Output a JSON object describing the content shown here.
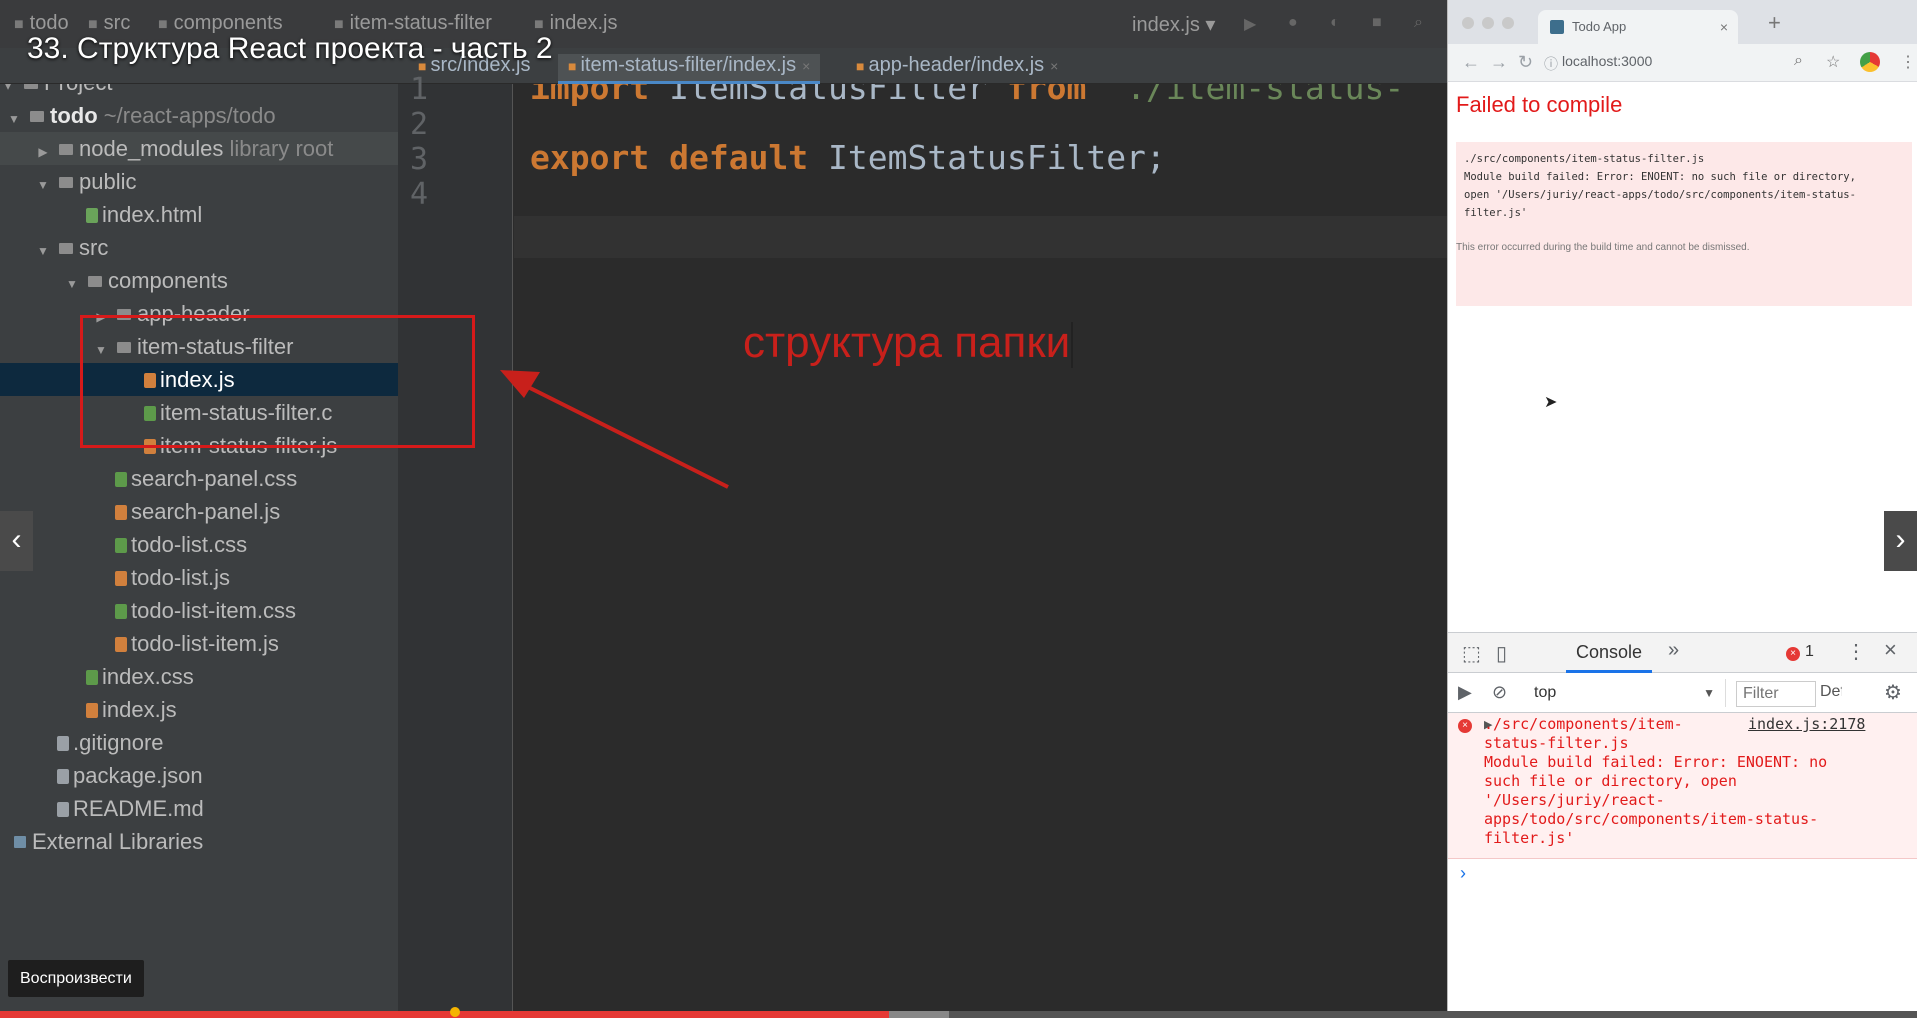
{
  "video": {
    "title": "33. Структура React проекта - часть 2",
    "play_label": "Воспроизвести",
    "prev_icon": "‹",
    "next_icon": "›",
    "progress": {
      "played_fraction": 0.464,
      "buffered_fraction": 0.495,
      "knob_fraction": 0.235
    }
  },
  "ide": {
    "breadcrumbs": [
      "todo",
      "src",
      "components",
      "item-status-filter",
      "index.js"
    ],
    "run_config": "index.js ▾",
    "tabs": [
      {
        "label": "src/index.js",
        "active": false
      },
      {
        "label": "item-status-filter/index.js",
        "active": true
      },
      {
        "label": "app-header/index.js",
        "active": false
      }
    ],
    "project_header": "Project",
    "tree": [
      {
        "label": "todo",
        "hint": "~/react-apps/todo",
        "type": "folder",
        "depth": 0,
        "expanded": true,
        "bold": true
      },
      {
        "label": "node_modules",
        "hint": "library root",
        "type": "folder",
        "depth": 1,
        "expanded": false,
        "alt": true
      },
      {
        "label": "public",
        "type": "folder",
        "depth": 1,
        "expanded": true
      },
      {
        "label": "index.html",
        "type": "html",
        "depth": 2
      },
      {
        "label": "src",
        "type": "folder",
        "depth": 1,
        "expanded": true
      },
      {
        "label": "components",
        "type": "folder",
        "depth": 2,
        "expanded": true
      },
      {
        "label": "app-header",
        "type": "folder",
        "depth": 3,
        "expanded": false
      },
      {
        "label": "item-status-filter",
        "type": "folder",
        "depth": 3,
        "expanded": true
      },
      {
        "label": "index.js",
        "type": "js",
        "depth": 4,
        "selected": true
      },
      {
        "label": "item-status-filter.c",
        "type": "css",
        "depth": 4
      },
      {
        "label": "item-status-filter.js",
        "type": "js",
        "depth": 4
      },
      {
        "label": "search-panel.css",
        "type": "css",
        "depth": 3
      },
      {
        "label": "search-panel.js",
        "type": "js",
        "depth": 3
      },
      {
        "label": "todo-list.css",
        "type": "css",
        "depth": 3
      },
      {
        "label": "todo-list.js",
        "type": "js",
        "depth": 3
      },
      {
        "label": "todo-list-item.css",
        "type": "css",
        "depth": 3
      },
      {
        "label": "todo-list-item.js",
        "type": "js",
        "depth": 3
      },
      {
        "label": "index.css",
        "type": "css",
        "depth": 2
      },
      {
        "label": "index.js",
        "type": "js",
        "depth": 2
      },
      {
        "label": ".gitignore",
        "type": "gen",
        "depth": 1
      },
      {
        "label": "package.json",
        "type": "gen",
        "depth": 1
      },
      {
        "label": "README.md",
        "type": "gen",
        "depth": 1
      },
      {
        "label": "External Libraries",
        "type": "lib",
        "depth": 0
      }
    ],
    "line_numbers": [
      "1",
      "2",
      "3",
      "4"
    ],
    "code": {
      "line1": {
        "kw1": "import",
        "ident": "ItemStatusFilter",
        "kw2": "from",
        "str": "'./item-status-"
      },
      "line3": {
        "kw1": "export",
        "kw2": "default",
        "ident": "ItemStatusFilter;"
      }
    },
    "annotation": "структура папки"
  },
  "browser": {
    "tab_title": "Todo App",
    "url": "localhost:3000",
    "error_title": "Failed to compile",
    "error_body": "./src/components/item-status-filter.js\nModule build failed: Error: ENOENT: no such file or directory,\nopen '/Users/juriy/react-apps/todo/src/components/item-status-\nfilter.js'",
    "error_note": "This error occurred during the build time and cannot be dismissed.",
    "devtools": {
      "console_tab": "Console",
      "error_count": "1",
      "context": "top",
      "filter_placeholder": "Filter",
      "levels": "Default levels",
      "message": "./src/components/item-\nstatus-filter.js\nModule build failed: Error: ENOENT: no\nsuch file or directory, open\n'/Users/juriy/react-\napps/todo/src/components/item-status-\nfilter.js'",
      "source": "index.js:2178"
    }
  },
  "colors": {
    "annotation": "#c8201b",
    "error": "#e21a1a",
    "accent": "#4a88c7"
  }
}
